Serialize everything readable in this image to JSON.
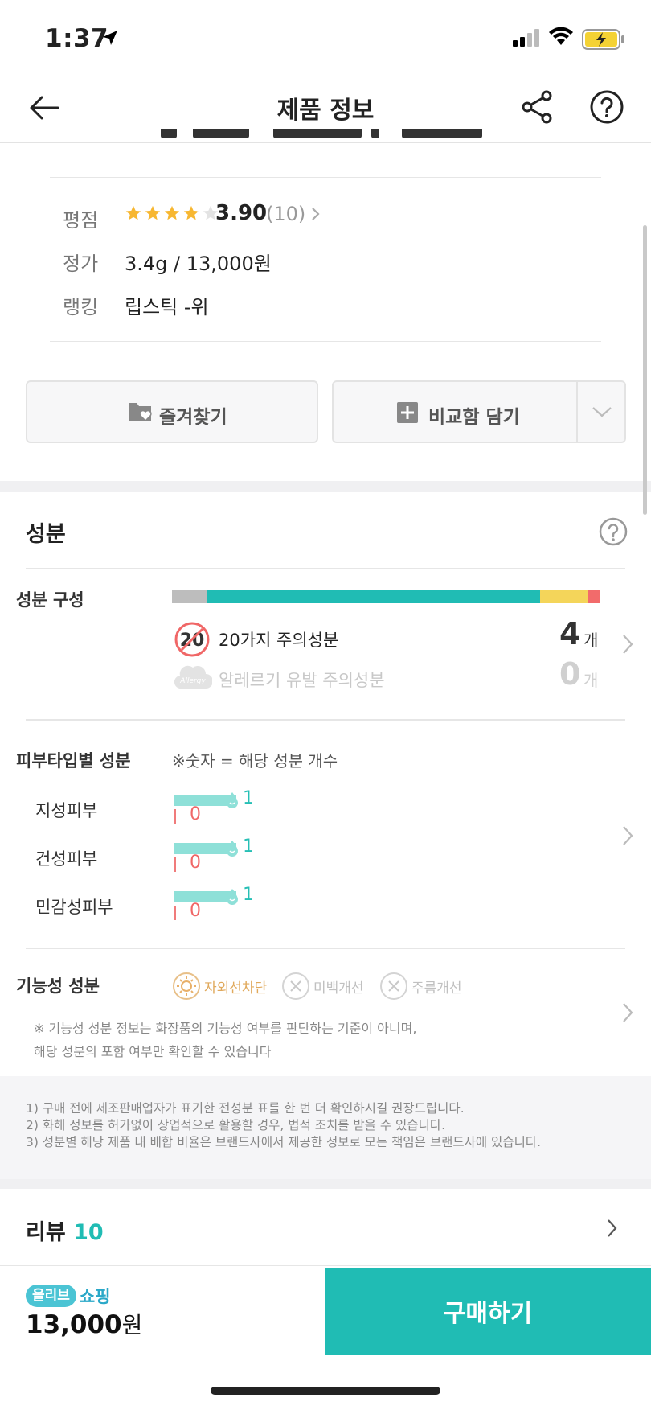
{
  "status": {
    "time": "1:37"
  },
  "header": {
    "title": "제품 정보"
  },
  "info": {
    "rating_label": "평점",
    "rating_value": "3.90",
    "rating_count": "(10)",
    "rating_stars": 3.9,
    "price_label": "정가",
    "price_value": "3.4g / 13,000원",
    "ranking_label": "랭킹",
    "ranking_value": "립스틱 -위"
  },
  "buttons": {
    "favorite": "즐겨찾기",
    "compare": "비교함 담기"
  },
  "ingredients": {
    "title": "성분",
    "composition_label": "성분 구성",
    "composition_bar": [
      {
        "color": "#bdbdbd",
        "fraction": 0.074
      },
      {
        "color": "#20bcb4",
        "fraction": 0.695
      },
      {
        "color": "#f4d55a",
        "fraction": 0.1
      },
      {
        "color": "#f26b6b",
        "fraction": 0.025
      }
    ],
    "caution20_badge": "20",
    "caution20_label": "20가지 주의성분",
    "caution20_count": "4",
    "allergy_badge": "Allergy",
    "allergy_label": "알레르기 유발 주의성분",
    "allergy_count": "0",
    "unit": "개",
    "skin_label": "피부타입별 성분",
    "skin_note": "※숫자 = 해당 성분 개수",
    "skin_types": [
      {
        "name": "지성피부",
        "good": "1",
        "bad": "0"
      },
      {
        "name": "건성피부",
        "good": "1",
        "bad": "0"
      },
      {
        "name": "민감성피부",
        "good": "1",
        "bad": "0"
      }
    ],
    "functional_label": "기능성 성분",
    "functional_items": [
      {
        "label": "자외선차단",
        "active": true
      },
      {
        "label": "미백개선",
        "active": false
      },
      {
        "label": "주름개선",
        "active": false
      }
    ],
    "functional_note_1": "※ 기능성 성분 정보는 화장품의 기능성 여부를 판단하는 기준이 아니며,",
    "functional_note_2": "해당 성분의 포함 여부만 확인할 수 있습니다",
    "disclaimers": [
      "1) 구매 전에 제조판매업자가 표기한 전성분 표를 한 번 더 확인하시길 권장드립니다.",
      "2) 화해 정보를 허가없이 상업적으로 활용할 경우, 법적 조치를 받을 수 있습니다.",
      "3) 성분별 해당 제품 내 배합 비율은 브랜드사에서 제공한 정보로 모든 책임은 브랜드사에 있습니다."
    ]
  },
  "review": {
    "label": "리뷰",
    "count": "10"
  },
  "bottom": {
    "shop_logo": "올리브",
    "shop_label": "쇼핑",
    "price": "13,000",
    "price_unit": "원",
    "buy": "구매하기"
  },
  "colors": {
    "accent": "#20bcb4",
    "star": "#f7b731",
    "warn": "#f26b6b"
  }
}
